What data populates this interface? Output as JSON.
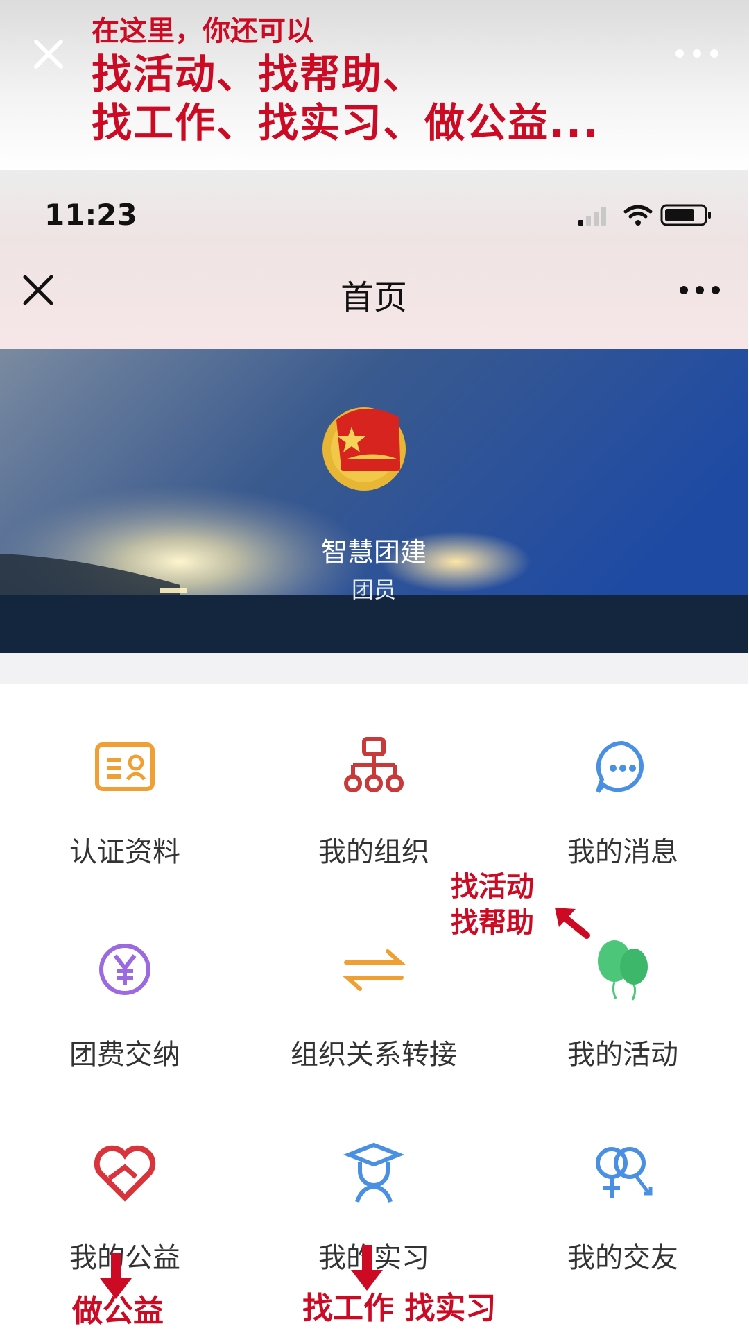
{
  "promo": {
    "line1": "在这里，你还可以",
    "line2": "找活动、找帮助、",
    "line3": "找工作、找实习、做公益..."
  },
  "status": {
    "time": "11:23"
  },
  "nav": {
    "title": "首页"
  },
  "hero": {
    "title": "智慧团建",
    "role": "团员"
  },
  "grid": [
    {
      "label": "认证资料",
      "icon": "id-card-icon",
      "color": "#f0a033"
    },
    {
      "label": "我的组织",
      "icon": "org-chart-icon",
      "color": "#c83a3a"
    },
    {
      "label": "我的消息",
      "icon": "chat-bubble-icon",
      "color": "#4a90e2"
    },
    {
      "label": "团费交纳",
      "icon": "yen-icon",
      "color": "#9b6ae0"
    },
    {
      "label": "组织关系转接",
      "icon": "transfer-arrows-icon",
      "color": "#f0a033"
    },
    {
      "label": "我的活动",
      "icon": "balloons-icon",
      "color": "#4cc77a"
    },
    {
      "label": "我的公益",
      "icon": "heart-hand-icon",
      "color": "#d9343b"
    },
    {
      "label": "我的实习",
      "icon": "graduate-icon",
      "color": "#4a90e2"
    },
    {
      "label": "我的交友",
      "icon": "gender-icon",
      "color": "#4a90e2"
    }
  ],
  "annotations": {
    "activity_line1": "找活动",
    "activity_line2": "找帮助",
    "charity": "做公益",
    "work": "找工作 找实习",
    "color": "#cc0a23"
  }
}
